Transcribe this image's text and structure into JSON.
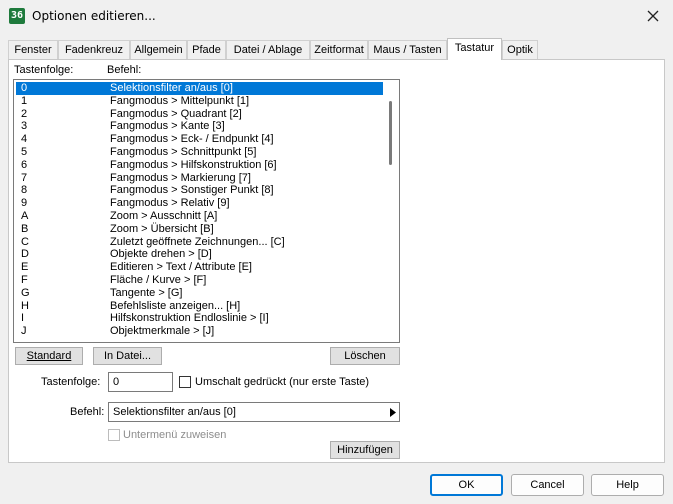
{
  "window": {
    "title": "Optionen editieren...",
    "app_icon_text": "36"
  },
  "tabs": [
    {
      "label": "Fenster"
    },
    {
      "label": "Fadenkreuz"
    },
    {
      "label": "Allgemein"
    },
    {
      "label": "Pfade"
    },
    {
      "label": "Datei / Ablage"
    },
    {
      "label": "Zeitformat"
    },
    {
      "label": "Maus / Tasten"
    },
    {
      "label": "Tastatur",
      "active": true
    },
    {
      "label": "Optik"
    }
  ],
  "list": {
    "header_key": "Tastenfolge:",
    "header_command": "Befehl:",
    "rows": [
      {
        "key": "0",
        "command": "Selektionsfilter an/aus [0]",
        "selected": true
      },
      {
        "key": "1",
        "command": "Fangmodus > Mittelpunkt [1]"
      },
      {
        "key": "2",
        "command": "Fangmodus > Quadrant [2]"
      },
      {
        "key": "3",
        "command": "Fangmodus > Kante [3]"
      },
      {
        "key": "4",
        "command": "Fangmodus > Eck- / Endpunkt [4]"
      },
      {
        "key": "5",
        "command": "Fangmodus > Schnittpunkt [5]"
      },
      {
        "key": "6",
        "command": "Fangmodus > Hilfskonstruktion [6]"
      },
      {
        "key": "7",
        "command": "Fangmodus > Markierung [7]"
      },
      {
        "key": "8",
        "command": "Fangmodus > Sonstiger Punkt [8]"
      },
      {
        "key": "9",
        "command": "Fangmodus > Relativ [9]"
      },
      {
        "key": "A",
        "command": "Zoom > Ausschnitt [A]"
      },
      {
        "key": "B",
        "command": "Zoom > Übersicht [B]"
      },
      {
        "key": "C",
        "command": "Zuletzt geöffnete Zeichnungen... [C]"
      },
      {
        "key": "D",
        "command": "Objekte drehen > [D]"
      },
      {
        "key": "E",
        "command": "Editieren > Text / Attribute [E]"
      },
      {
        "key": "F",
        "command": "Fläche / Kurve > [F]"
      },
      {
        "key": "G",
        "command": "Tangente > [G]"
      },
      {
        "key": "H",
        "command": "Befehlsliste anzeigen... [H]"
      },
      {
        "key": "I",
        "command": "Hilfskonstruktion Endloslinie > [I]"
      },
      {
        "key": "J",
        "command": "Objektmerkmale > [J]"
      }
    ]
  },
  "buttons": {
    "standard": "Standard",
    "in_datei": "In Datei...",
    "loeschen": "Löschen",
    "hinzufuegen": "Hinzufügen",
    "ok": "OK",
    "cancel": "Cancel",
    "help": "Help"
  },
  "form": {
    "tastenfolge_label": "Tastenfolge:",
    "tastenfolge_value": "0",
    "umschalt_label": "Umschalt gedrückt (nur erste Taste)",
    "umschalt_checked": false,
    "befehl_label": "Befehl:",
    "befehl_value": "Selektionsfilter an/aus [0]",
    "untermenu_label": "Untermenü zuweisen",
    "untermenu_checked": false,
    "untermenu_enabled": false
  },
  "colors": {
    "selection": "#0078d7",
    "background": "#f0f0f0",
    "primary_border": "#0078d7"
  }
}
